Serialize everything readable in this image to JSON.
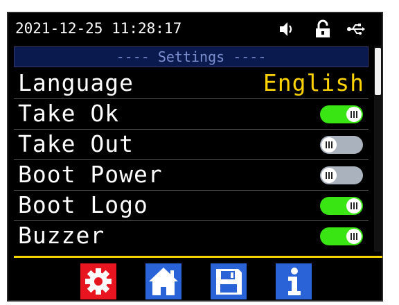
{
  "status": {
    "datetime": "2021-12-25 11:28:17",
    "icons": [
      "speaker-icon",
      "unlock-icon",
      "usb-icon"
    ]
  },
  "header": {
    "title": "---- Settings ----"
  },
  "settings": [
    {
      "label": "Language",
      "value": "English"
    },
    {
      "label": "Take Ok",
      "state": "on"
    },
    {
      "label": "Take Out",
      "state": "off"
    },
    {
      "label": "Boot Power",
      "state": "off"
    },
    {
      "label": "Boot Logo",
      "state": "on"
    },
    {
      "label": "Buzzer",
      "state": "on"
    }
  ],
  "nav": [
    {
      "icon": "gear-icon",
      "color": "#e8141f"
    },
    {
      "icon": "home-icon",
      "color": "#2a63d8"
    },
    {
      "icon": "save-icon",
      "color": "#2a63d8"
    },
    {
      "icon": "info-icon",
      "color": "#2a63d8"
    }
  ],
  "colors": {
    "accent_yellow": "#f4d400",
    "toggle_on": "#39e614",
    "toggle_off": "#a9b2bd",
    "header_bg": "#0a1a4f"
  }
}
